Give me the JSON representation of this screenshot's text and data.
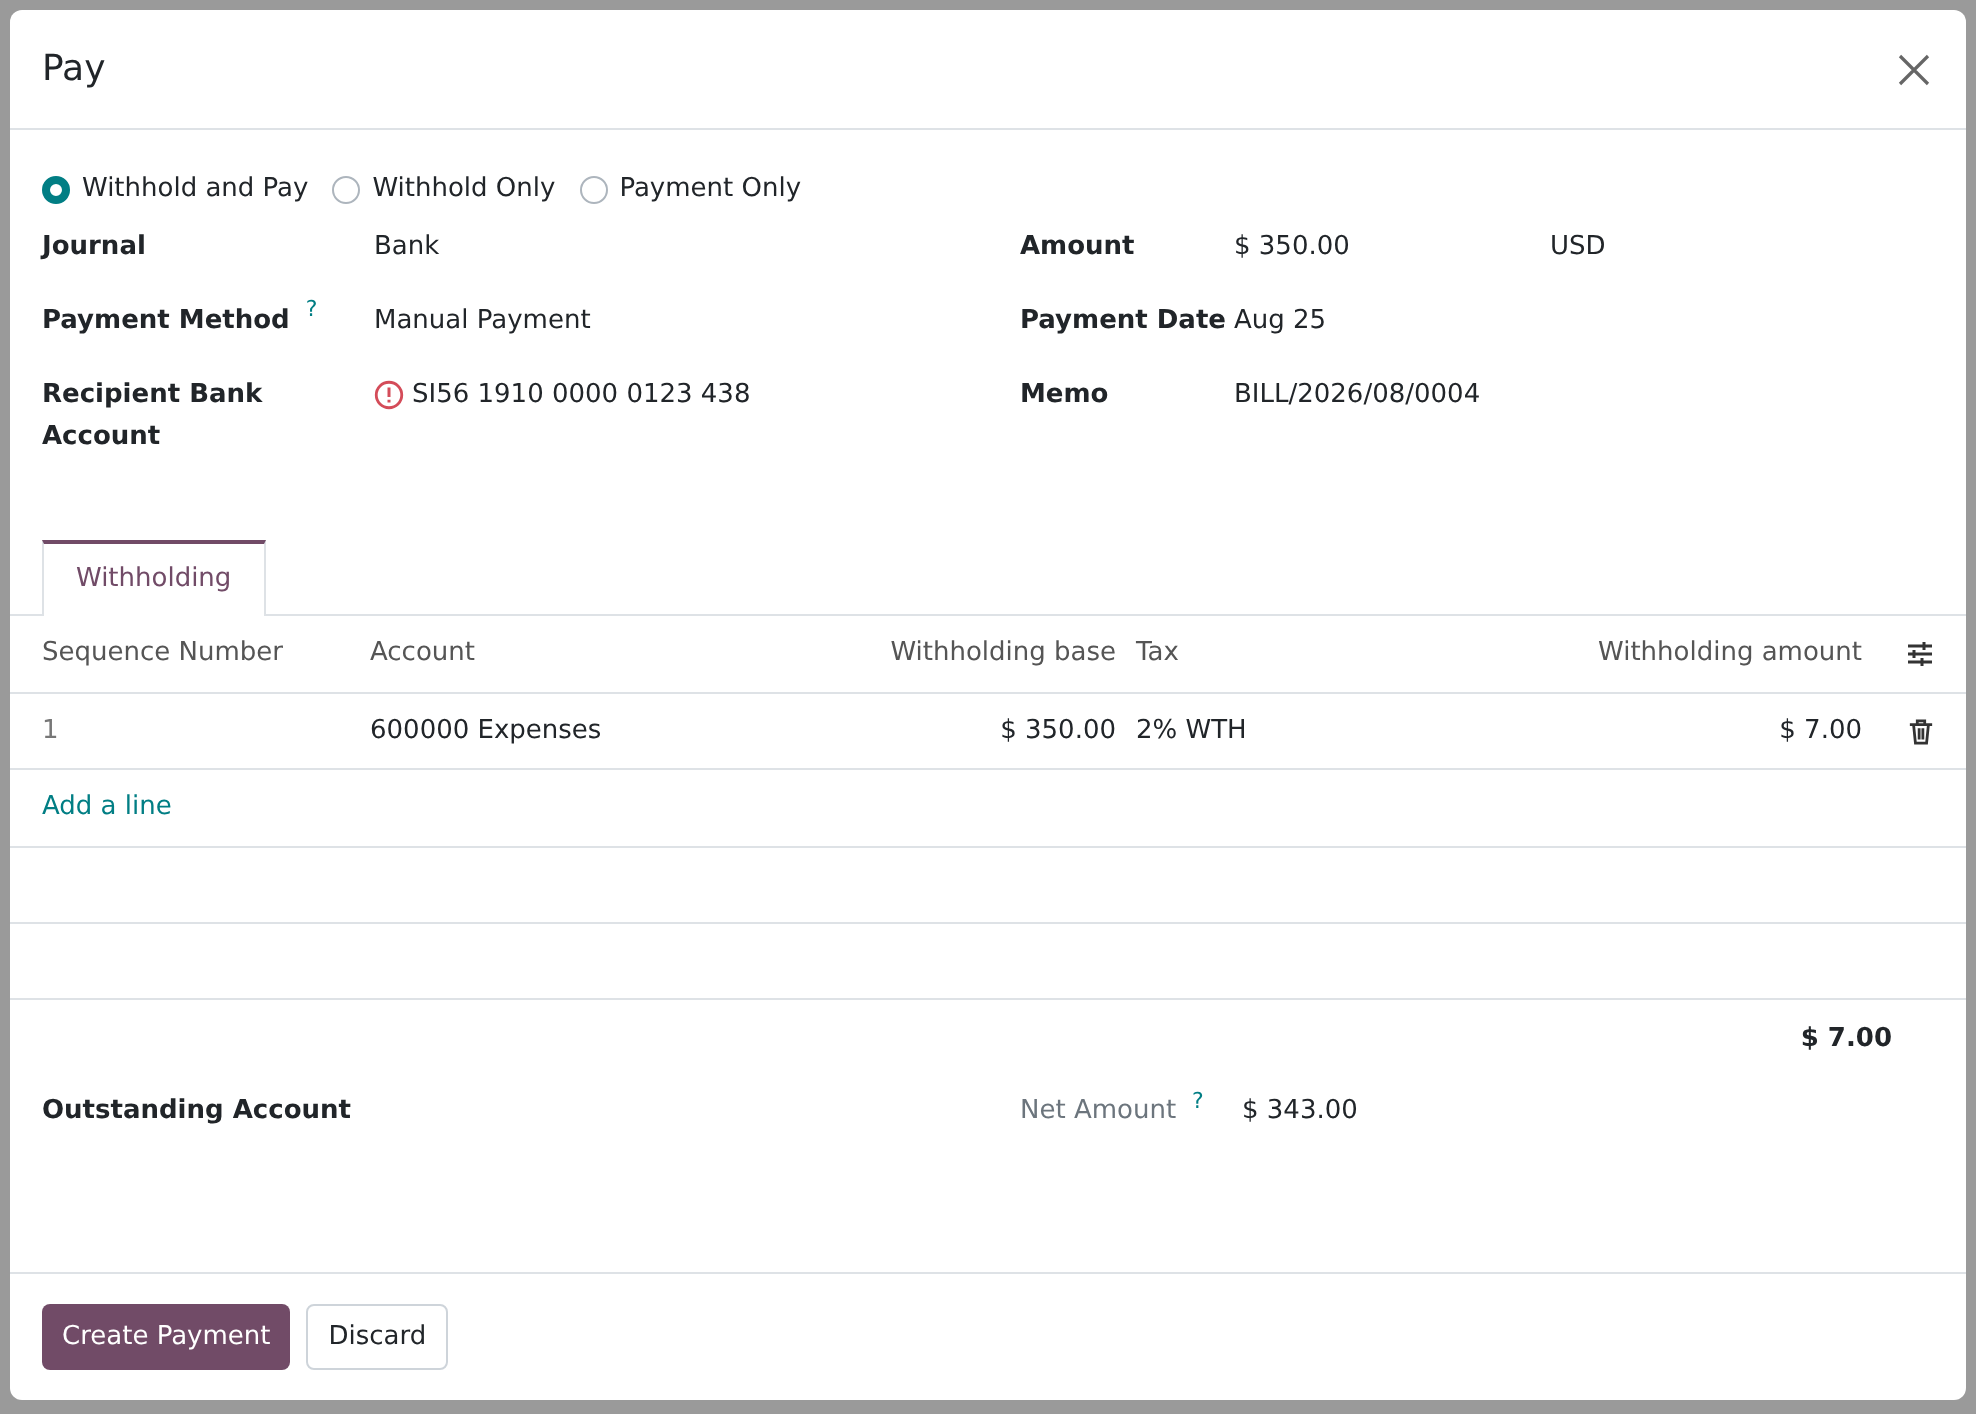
{
  "dialog": {
    "title": "Pay"
  },
  "options": [
    {
      "label": "Withhold and Pay",
      "selected": true
    },
    {
      "label": "Withhold Only",
      "selected": false
    },
    {
      "label": "Payment Only",
      "selected": false
    }
  ],
  "left_fields": [
    {
      "label": "Journal",
      "value": "Bank",
      "warning": false
    },
    {
      "label": "Payment Method",
      "value": "Manual Payment",
      "help": "?",
      "warning": false
    },
    {
      "label": "Recipient Bank Account",
      "value": "SI56 1910 0000 0123 438",
      "warning": true
    }
  ],
  "right_fields": [
    {
      "label": "Amount",
      "value": "$ 350.00",
      "currency": "USD"
    },
    {
      "label": "Payment Date",
      "value": "Aug 25"
    },
    {
      "label": "Memo",
      "value": "BILL/2026/08/0004"
    }
  ],
  "tabs": [
    {
      "label": "Withholding",
      "selected": true
    }
  ],
  "table": {
    "columns": [
      "Sequence Number",
      "Account",
      "Withholding base",
      "Tax",
      "Withholding amount"
    ],
    "rows": [
      {
        "cells": [
          "1",
          "600000 Expenses",
          "$ 350.00",
          "2% WTH",
          "$ 7.00"
        ]
      }
    ],
    "add_line": "Add a line",
    "total": "$ 7.00"
  },
  "outstanding_account": {
    "label": "Outstanding Account"
  },
  "net_amount": {
    "label": "Net Amount",
    "help": "?",
    "value": "$ 343.00"
  },
  "buttons": [
    {
      "label": "Create Payment",
      "kind": "primary"
    },
    {
      "label": "Discard",
      "kind": "secondary"
    }
  ]
}
